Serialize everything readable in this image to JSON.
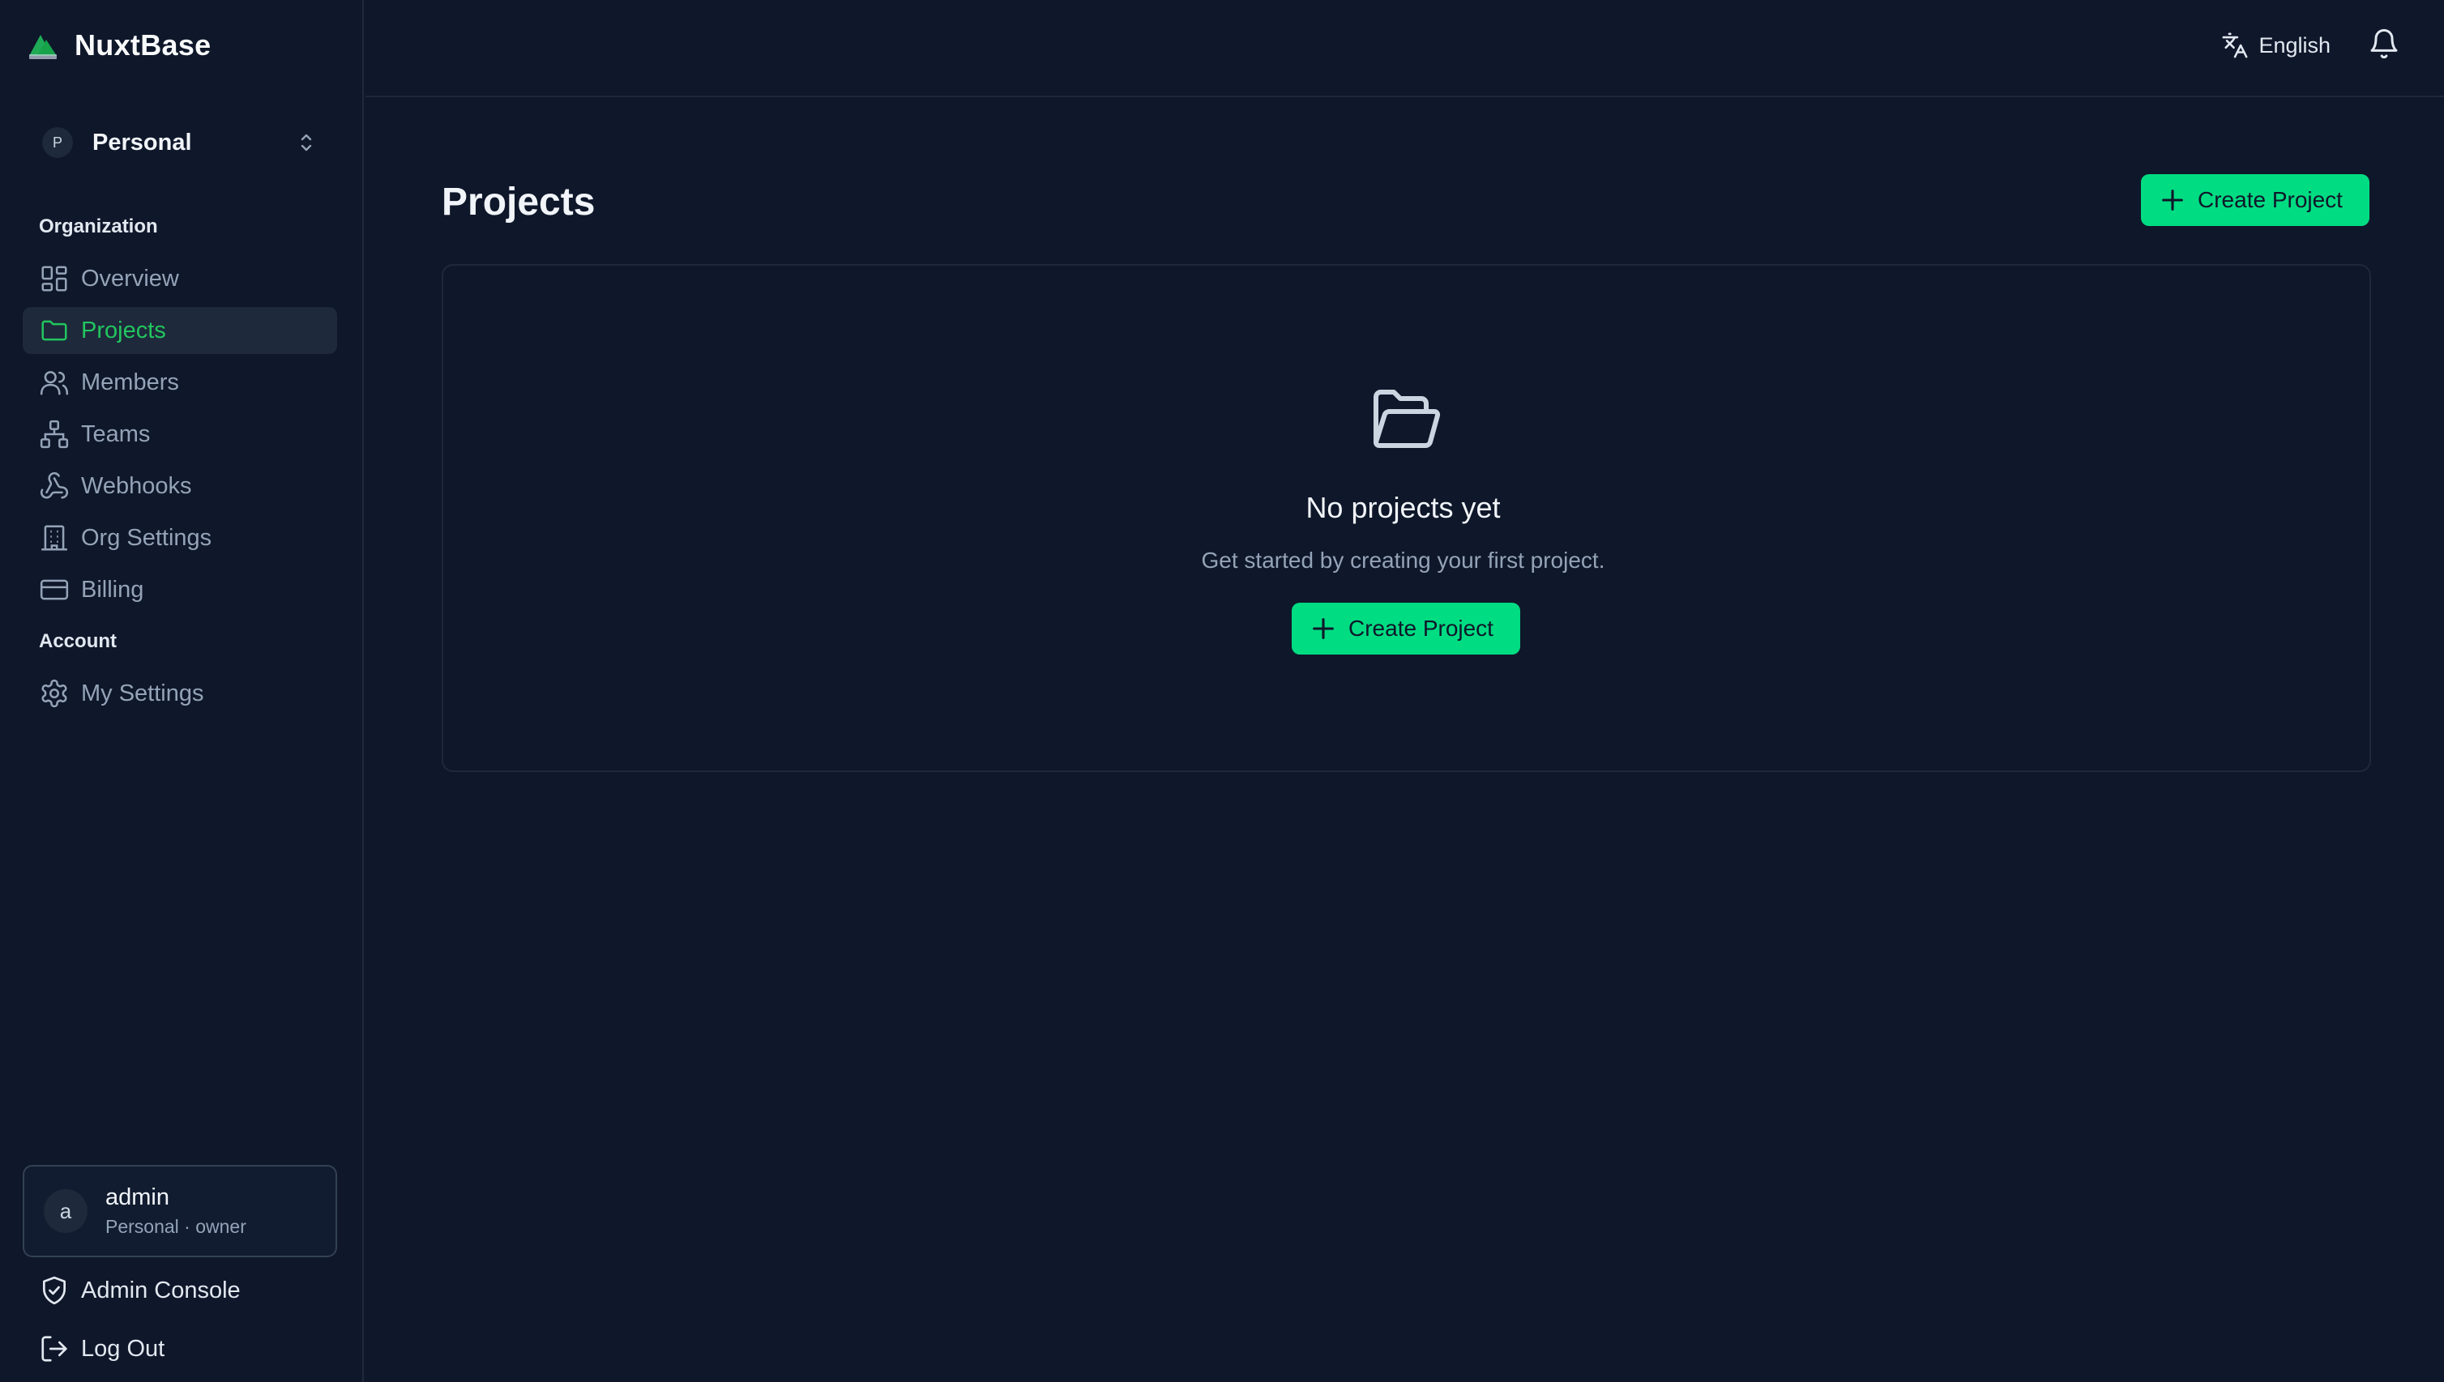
{
  "app": {
    "name": "NuxtBase"
  },
  "org_switcher": {
    "avatar_letter": "P",
    "name": "Personal"
  },
  "sidebar": {
    "organization_label": "Organization",
    "account_label": "Account",
    "items": [
      {
        "label": "Overview",
        "icon": "layout-grid-icon",
        "active": false
      },
      {
        "label": "Projects",
        "icon": "folder-icon",
        "active": true
      },
      {
        "label": "Members",
        "icon": "users-icon",
        "active": false
      },
      {
        "label": "Teams",
        "icon": "network-icon",
        "active": false
      },
      {
        "label": "Webhooks",
        "icon": "webhook-icon",
        "active": false
      },
      {
        "label": "Org Settings",
        "icon": "building-icon",
        "active": false
      },
      {
        "label": "Billing",
        "icon": "credit-card-icon",
        "active": false
      }
    ],
    "account_items": [
      {
        "label": "My Settings",
        "icon": "gear-icon"
      }
    ]
  },
  "user": {
    "avatar_letter": "a",
    "name": "admin",
    "role": "Personal · owner"
  },
  "footer_links": {
    "admin_console": "Admin Console",
    "log_out": "Log Out"
  },
  "topbar": {
    "language": "English"
  },
  "main": {
    "title": "Projects",
    "create_button": "Create Project",
    "empty": {
      "title": "No projects yet",
      "description": "Get started by creating your first project.",
      "button": "Create Project"
    }
  },
  "colors": {
    "background": "#0f172a",
    "accent": "#00dc82",
    "active_text": "#22c55e",
    "muted": "#94a3b8"
  }
}
